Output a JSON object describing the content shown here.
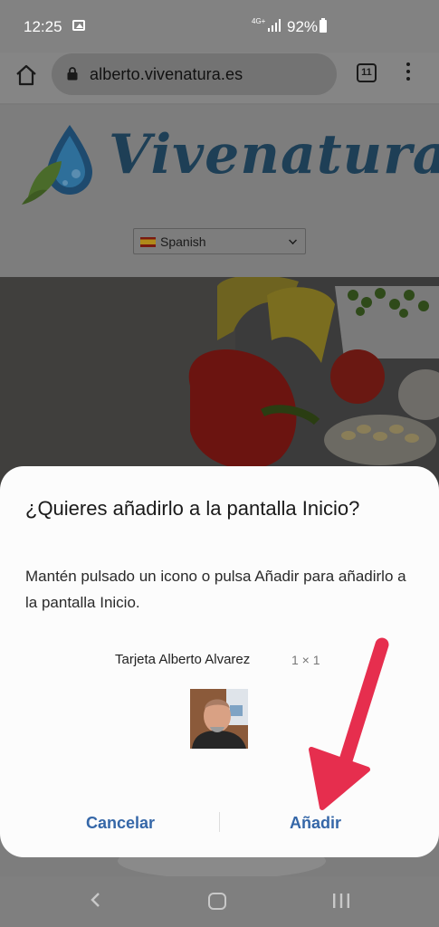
{
  "status": {
    "time": "12:25",
    "network": "4G+",
    "battery": "92%"
  },
  "browser": {
    "url": "alberto.vivenatura.es",
    "tab_count": "11"
  },
  "page": {
    "logo_text": "Vivenatura",
    "language": "Spanish"
  },
  "dialog": {
    "title": "¿Quieres añadirlo a la pantalla Inicio?",
    "message": "Mantén pulsado un icono o pulsa Añadir para añadirlo a la pantalla Inicio.",
    "shortcut_name": "Tarjeta Alberto Alvarez",
    "shortcut_size": "1 × 1",
    "cancel_label": "Cancelar",
    "add_label": "Añadir"
  },
  "colors": {
    "accent": "#3567a8",
    "arrow": "#e62e4e"
  }
}
